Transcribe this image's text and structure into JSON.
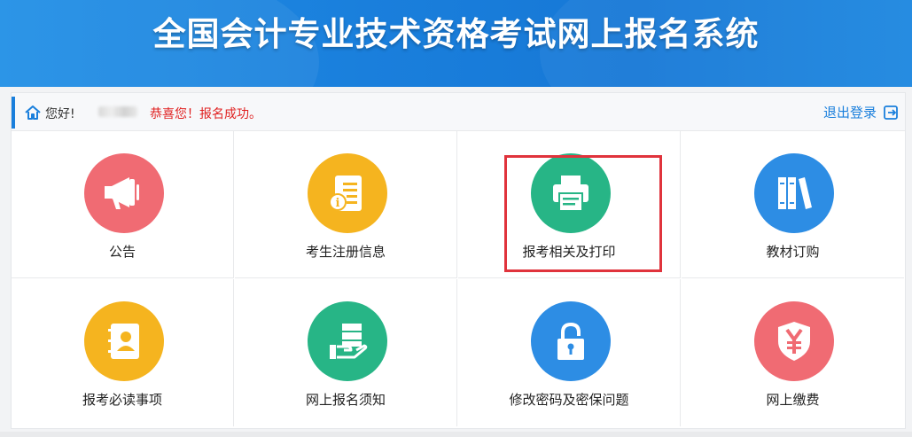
{
  "header": {
    "title": "全国会计专业技术资格考试网上报名系统"
  },
  "welcome": {
    "greeting": "您好!",
    "message": "恭喜您！报名成功。",
    "logout_label": "退出登录"
  },
  "colors": {
    "red": "#f06b73",
    "yellow": "#f5b41f",
    "green": "#27b586",
    "blue": "#2d8de4",
    "highlight": "#e0333c"
  },
  "menu": [
    {
      "label": "公告",
      "icon": "megaphone-icon"
    },
    {
      "label": "考生注册信息",
      "icon": "info-document-icon"
    },
    {
      "label": "报考相关及打印",
      "icon": "printer-icon",
      "highlighted": true
    },
    {
      "label": "教材订购",
      "icon": "books-icon"
    },
    {
      "label": "报考必读事项",
      "icon": "address-book-icon"
    },
    {
      "label": "网上报名须知",
      "icon": "hand-with-document-icon"
    },
    {
      "label": "修改密码及密保问题",
      "icon": "padlock-icon"
    },
    {
      "label": "网上缴费",
      "icon": "yen-shield-icon"
    }
  ]
}
